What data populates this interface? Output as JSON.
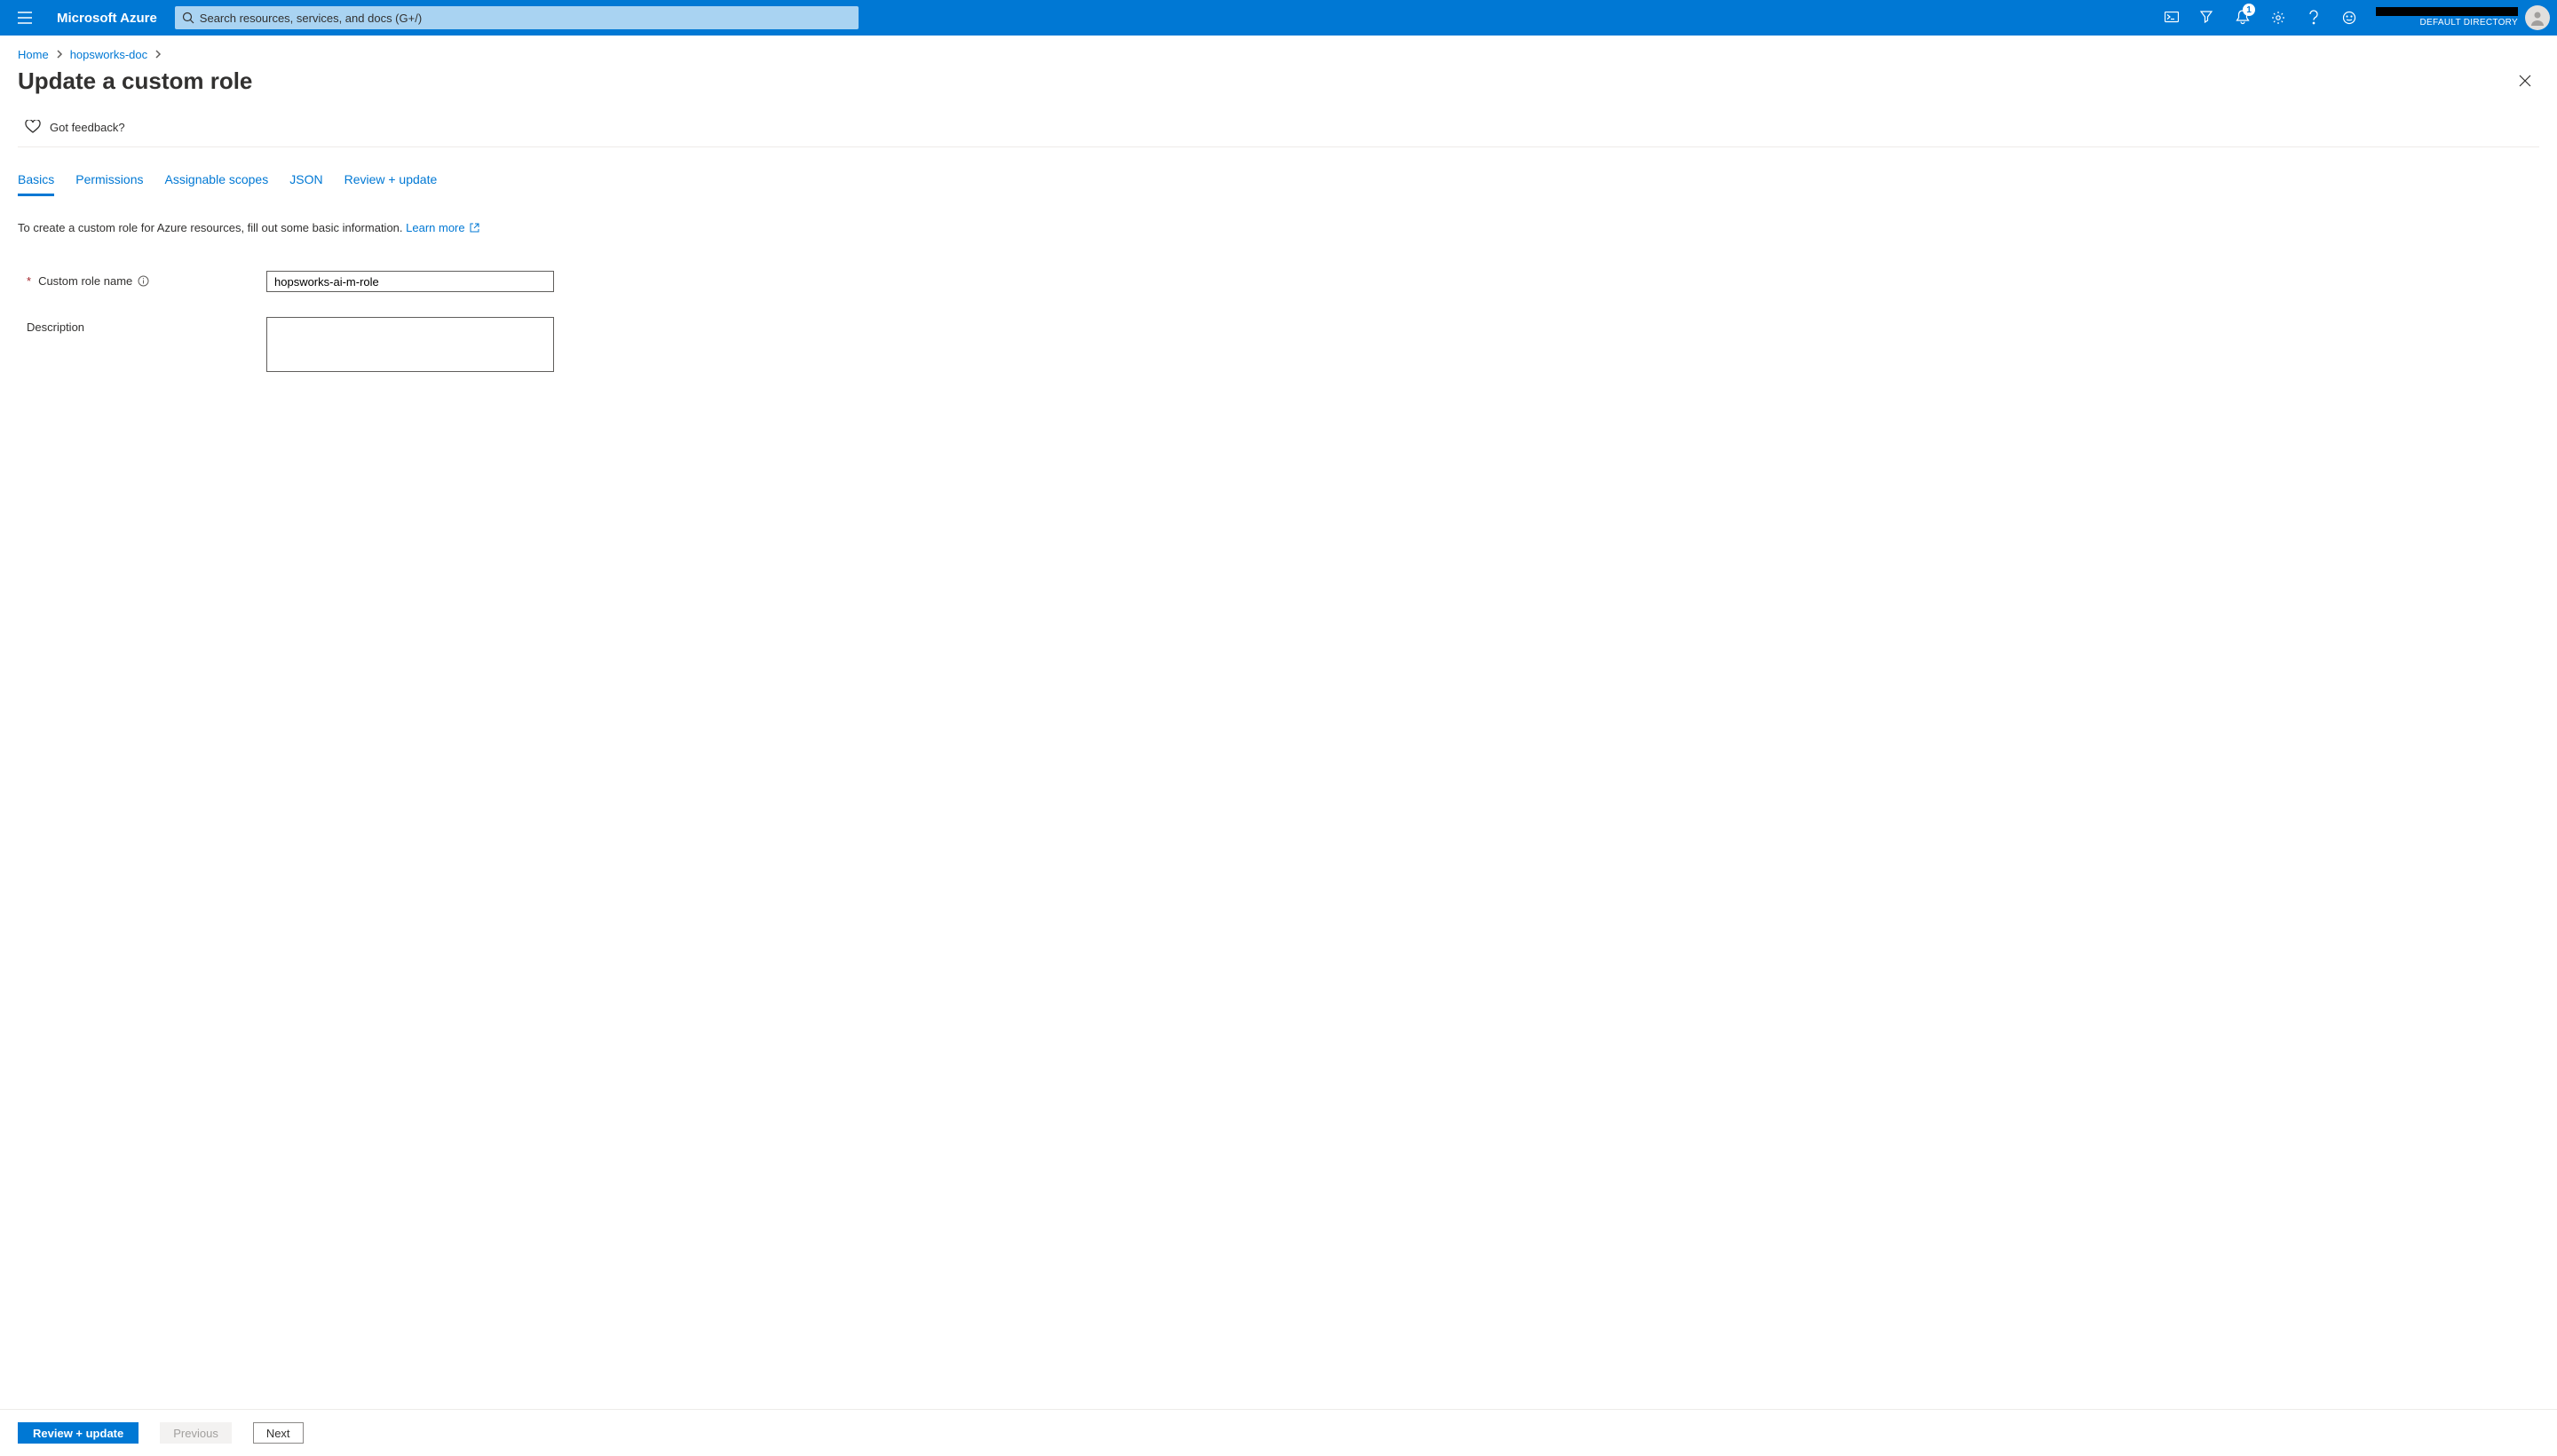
{
  "header": {
    "brand": "Microsoft Azure",
    "search_placeholder": "Search resources, services, and docs (G+/)",
    "notification_count": "1",
    "directory_label": "DEFAULT DIRECTORY"
  },
  "breadcrumb": {
    "items": [
      "Home",
      "hopsworks-doc"
    ]
  },
  "page": {
    "title": "Update a custom role",
    "feedback_label": "Got feedback?"
  },
  "tabs": {
    "items": [
      "Basics",
      "Permissions",
      "Assignable scopes",
      "JSON",
      "Review + update"
    ],
    "active_index": 0
  },
  "help": {
    "text": "To create a custom role for Azure resources, fill out some basic information. ",
    "link": "Learn more"
  },
  "form": {
    "role_name_label": "Custom role name",
    "role_name_value": "hopsworks-ai-m-role",
    "description_label": "Description",
    "description_value": ""
  },
  "footer": {
    "primary": "Review + update",
    "previous": "Previous",
    "next": "Next"
  }
}
